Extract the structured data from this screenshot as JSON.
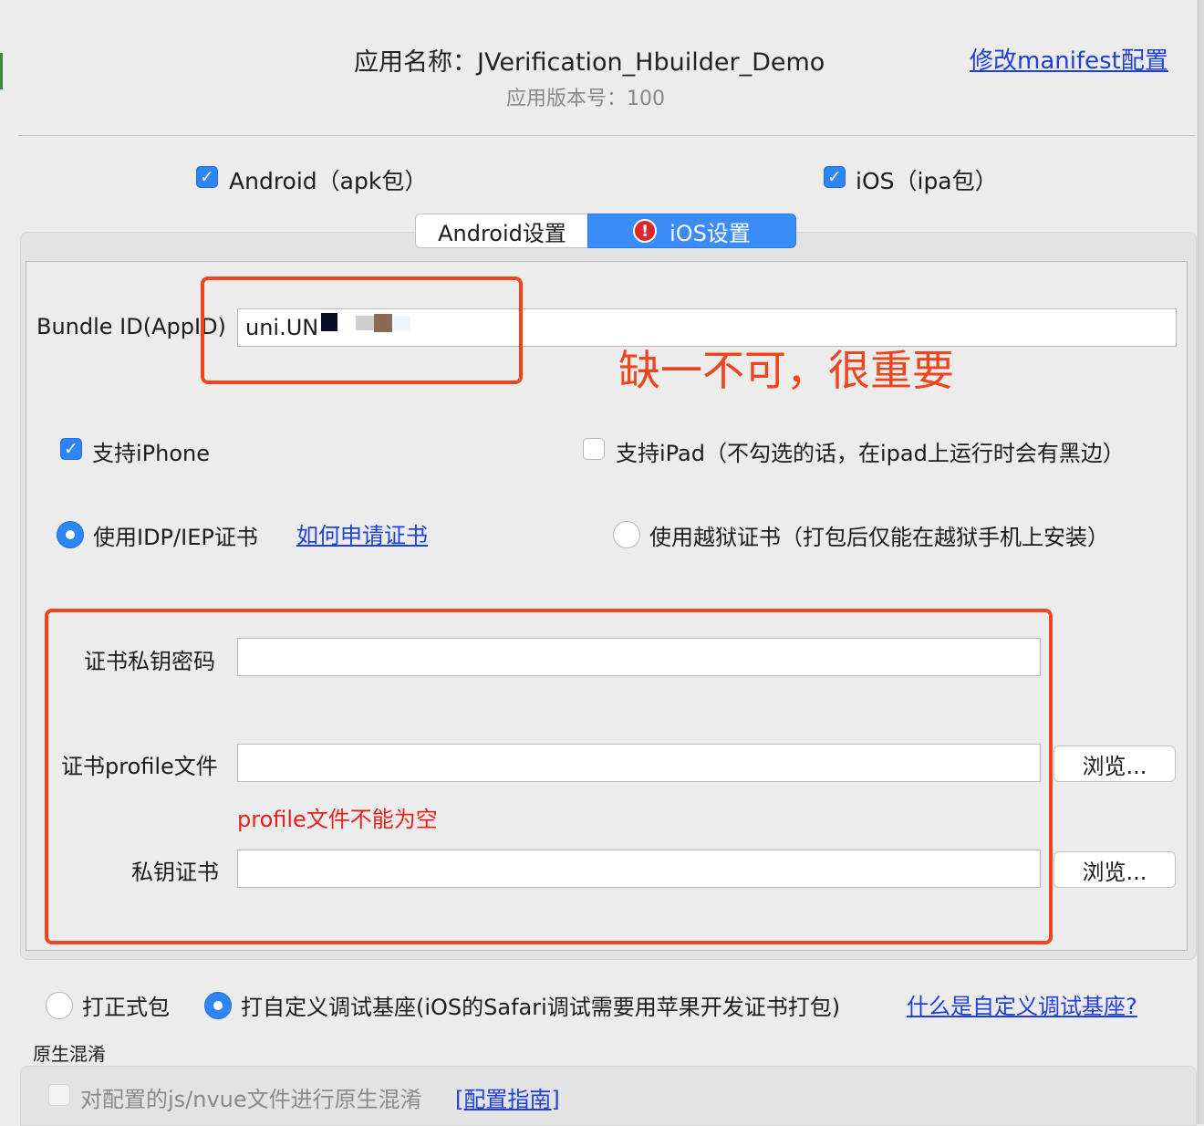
{
  "header": {
    "app_name": "应用名称：JVerification_Hbuilder_Demo",
    "app_version": "应用版本号：100",
    "manifest_link": "修改manifest配置"
  },
  "platforms": {
    "android": {
      "label": "Android（apk包）",
      "checked": true
    },
    "ios": {
      "label": "iOS（ipa包）",
      "checked": true
    }
  },
  "tabs": [
    {
      "label": "Android设置",
      "selected": false
    },
    {
      "label": "iOS设置",
      "selected": true,
      "icon": "error-icon"
    }
  ],
  "ios_settings": {
    "bundle_id": {
      "label": "Bundle ID(AppID)",
      "value": "uni.UN"
    },
    "annotation": "缺一不可，很重要",
    "support_iphone": {
      "label": "支持iPhone",
      "checked": true
    },
    "support_ipad": {
      "label": "支持iPad（不勾选的话，在ipad上运行时会有黑边）",
      "checked": false
    },
    "cert_type": {
      "idp": {
        "label": "使用IDP/IEP证书",
        "selected": true
      },
      "how_to_link": "如何申请证书",
      "jailbreak": {
        "label": "使用越狱证书（打包后仅能在越狱手机上安装）",
        "selected": false
      }
    },
    "cert_password": {
      "label": "证书私钥密码",
      "value": ""
    },
    "profile_file": {
      "label": "证书profile文件",
      "value": "",
      "error": "profile文件不能为空"
    },
    "private_key_cert": {
      "label": "私钥证书",
      "value": ""
    },
    "browse_label": "浏览..."
  },
  "package_type": {
    "formal": {
      "label": "打正式包",
      "selected": false
    },
    "custom_base": {
      "label": "打自定义调试基座(iOS的Safari调试需要用苹果开发证书打包)",
      "selected": true
    },
    "help_link": "什么是自定义调试基座?"
  },
  "obfuscation": {
    "section_title": "原生混淆",
    "option_label": "对配置的js/nvue文件进行原生混淆",
    "guide_link": "[配置指南]",
    "checked": false
  },
  "colors": {
    "accent_blue": "#2d86f5",
    "link_blue": "#1e3fdc",
    "annotation_red": "#f2441c",
    "error_red": "#e8211b"
  }
}
